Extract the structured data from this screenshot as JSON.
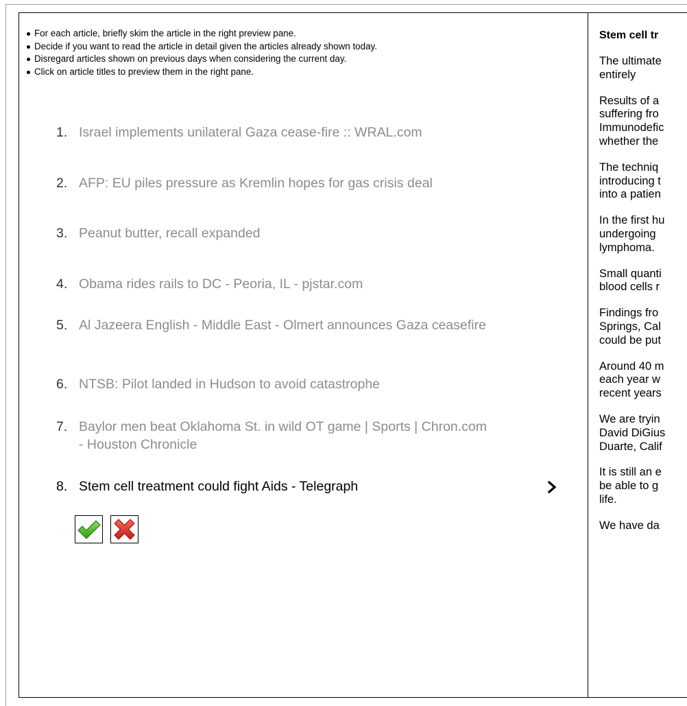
{
  "instructions": [
    "For each article, briefly skim the article in the right preview pane.",
    "Decide if you want to read the article in detail given the articles already shown today.",
    "Disregard articles shown on previous days when considering the current day.",
    "Click on article titles to preview them in the right pane."
  ],
  "articles": [
    {
      "num": "1.",
      "title": "Israel implements unilateral Gaza cease-fire :: WRAL.com"
    },
    {
      "num": "2.",
      "title": "AFP: EU piles pressure as Kremlin hopes for gas crisis deal"
    },
    {
      "num": "3.",
      "title": "Peanut butter, recall expanded"
    },
    {
      "num": "4.",
      "title": "Obama rides rails to DC - Peoria, IL - pjstar.com"
    },
    {
      "num": "5.",
      "title": "Al Jazeera English - Middle East - Olmert announces Gaza ceasefire"
    },
    {
      "num": "6.",
      "title": "NTSB: Pilot landed in Hudson to avoid catastrophe"
    },
    {
      "num": "7.",
      "title": "Baylor men beat Oklahoma St. in wild OT game | Sports | Chron.com - Houston Chronicle"
    },
    {
      "num": "8.",
      "title": "Stem cell treatment could fight Aids - Telegraph"
    }
  ],
  "selected_article_index": 7,
  "icons": {
    "chevron": "chevron-right-icon",
    "accept": "green-check-icon",
    "reject": "red-x-icon"
  },
  "colors": {
    "unread_title": "#8c8c8c",
    "selected_title": "#000000",
    "accept_green": "#3faa1e",
    "reject_red": "#d9261c"
  },
  "preview": {
    "title": "Stem cell tr",
    "paragraphs": [
      "The ultimate\nentirely",
      "Results of a\nsuffering fro\nImmunodefic\nwhether the",
      "The techniq\nintroducing t\ninto a patien",
      "In the first hu\nundergoing \nlymphoma.",
      "Small quanti\nblood cells r",
      "Findings fro\nSprings, Cal\ncould be put",
      "Around 40 m\neach year w\nrecent years",
      "We are tryin\nDavid DiGius\nDuarte, Calif",
      "It is still an e\nbe able to g\nlife.",
      "We have da"
    ]
  }
}
